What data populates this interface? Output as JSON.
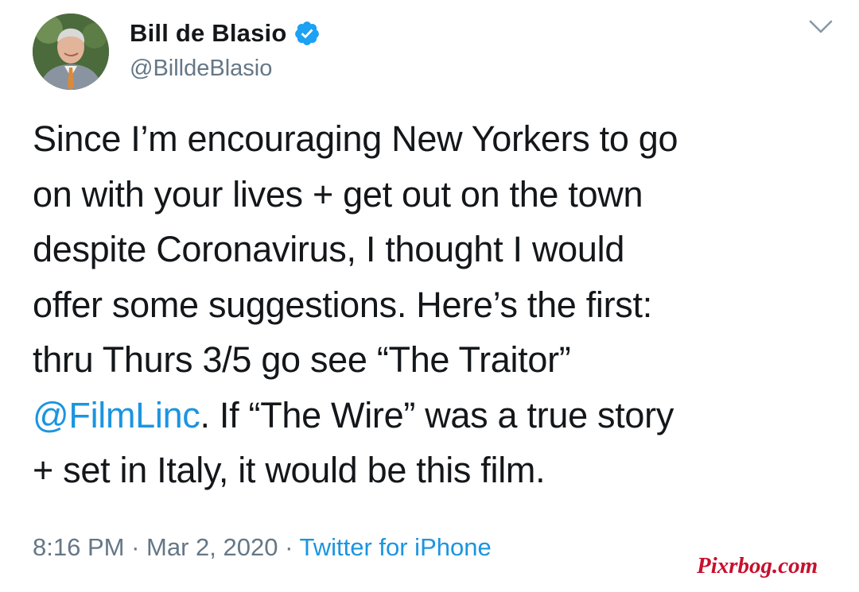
{
  "author": {
    "display_name": "Bill de Blasio",
    "handle": "@BilldeBlasio",
    "verified": true,
    "avatar_icon": "profile-photo"
  },
  "tweet": {
    "lines": [
      {
        "text": "Since I’m encouraging New Yorkers to go"
      },
      {
        "text": "on with your lives + get out on the town"
      },
      {
        "text": "despite Coronavirus, I thought I would"
      },
      {
        "text": "offer some suggestions. Here’s the first:"
      },
      {
        "text": "thru Thurs 3/5 go see “The Traitor”"
      },
      {
        "mention": "@FilmLinc",
        "text": ". If “The Wire” was a true story"
      },
      {
        "text": "+ set in Italy, it would be this film."
      }
    ]
  },
  "meta": {
    "time": "8:16 PM",
    "separator": "·",
    "date": "Mar 2, 2020",
    "source": "Twitter for iPhone"
  },
  "watermark": "Pixrbog.com",
  "colors": {
    "text": "#14171a",
    "secondary": "#657786",
    "link": "#1b95e0",
    "verified": "#1da1f2",
    "watermark": "#c8102e"
  }
}
